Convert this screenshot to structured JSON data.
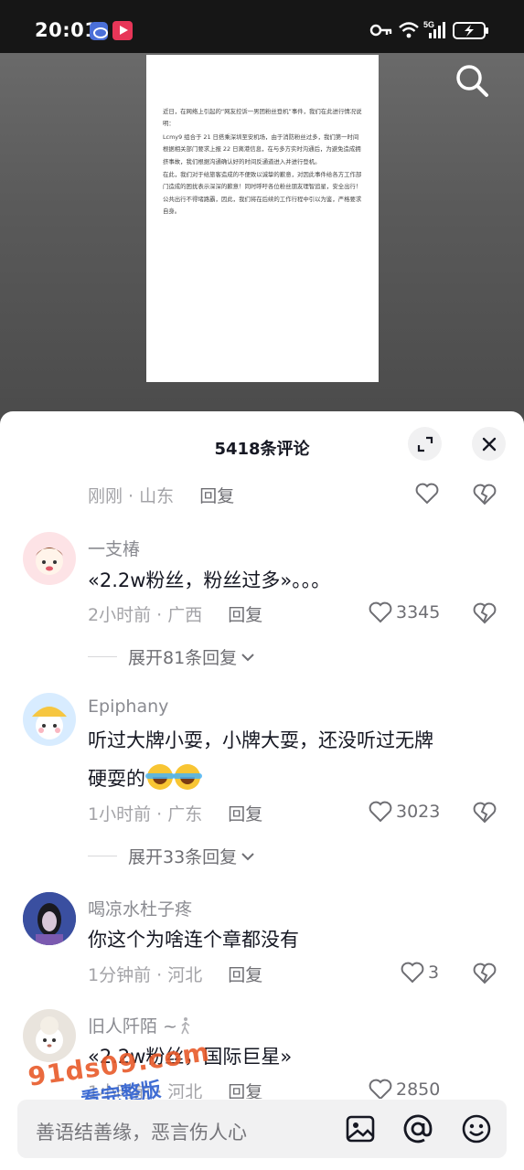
{
  "status_bar": {
    "time": "20:01",
    "network": "5G"
  },
  "video": {
    "document_paragraphs": [
      "近日，在网络上引起的“网友控诉一男团粉丝登机”事件，我们在此进行情况说明：",
      "Lcmy9 组合于 21 日搭乘深圳至安机场，由于消防粉丝过多，我们第一时间根据相关部门要求上报 22 日离港信息，在与多方实时沟通后，为避免造成拥挤事故，我们根据沟通确认好的时间反通道进入并进行登机。",
      "在此，我们对于给旅客造成的不便致以诚挚的歉意，对因此事件给各方工作部门造成的困扰表示深深的歉意！同时呼吁各位粉丝朋友理智追星，安全出行！公共出行不得堵路霸，因此，我们将在后续的工作行程中引以为鉴，严格要求自身。"
    ]
  },
  "comments_sheet": {
    "title": "5418条评论",
    "partial_top": {
      "time": "刚刚",
      "location": "山东",
      "reply_label": "回复"
    },
    "comments": [
      {
        "username": "一支椿",
        "text": "«2.2w粉丝，粉丝过多»。。。",
        "time": "2小时前",
        "location": "广西",
        "reply_label": "回复",
        "likes": "3345",
        "expand_label": "展开81条回复"
      },
      {
        "username": "Epiphany",
        "text_line1": "听过大牌小耍，小牌大耍，还没听过无牌",
        "text_line2": "硬耍的",
        "time": "1小时前",
        "location": "广东",
        "reply_label": "回复",
        "likes": "3023",
        "expand_label": "展开33条回复"
      },
      {
        "username": "喝凉水杜子疼",
        "text": "你这个为啥连个章都没有",
        "time": "1分钟前",
        "location": "河北",
        "reply_label": "回复",
        "likes": "3"
      },
      {
        "username": "旧人阡陌 ~",
        "text": "«2.2w粉丝，国际巨星»",
        "time": "1小时前",
        "location": "河北",
        "reply_label": "回复",
        "likes": "2850"
      }
    ]
  },
  "input_bar": {
    "placeholder": "善语结善缘，恶言伤人心"
  },
  "watermark": {
    "site": "91ds09.com",
    "tagline": "看完整版"
  },
  "colors": {
    "accent_dark": "#161823",
    "muted_text": "#a3a3a7",
    "sheet_bg": "#ffffff"
  }
}
